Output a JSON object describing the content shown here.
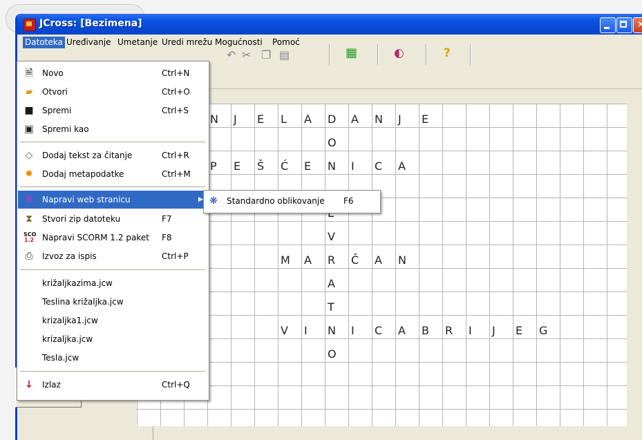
{
  "window": {
    "title": "JCross: [Bezimena]"
  },
  "menubar": [
    "Datoteka",
    "Uređivanje",
    "Umetanje",
    "Uredi mrežu",
    "Mogućnosti",
    "Pomoć"
  ],
  "file_menu": {
    "items": [
      {
        "label": "Novo",
        "shortcut": "Ctrl+N",
        "icon": "new-file-icon"
      },
      {
        "label": "Otvori",
        "shortcut": "Ctrl+O",
        "icon": "open-folder-icon"
      },
      {
        "label": "Spremi",
        "shortcut": "Ctrl+S",
        "icon": "save-disk-icon"
      },
      {
        "label": "Spremi kao",
        "shortcut": "",
        "icon": "save-as-icon"
      },
      {
        "label": "Dodaj tekst za čitanje",
        "shortcut": "Ctrl+R",
        "icon": "reading-text-icon"
      },
      {
        "label": "Dodaj metapodatke",
        "shortcut": "Ctrl+M",
        "icon": "metadata-icon"
      },
      {
        "label": "Napravi web stranicu",
        "shortcut": "",
        "icon": "web-page-icon"
      },
      {
        "label": "Stvori zip datoteku",
        "shortcut": "F7",
        "icon": "zip-icon"
      },
      {
        "label": "Napravi SCORM 1.2 paket",
        "shortcut": "F8",
        "icon": "scorm-icon"
      },
      {
        "label": "Izvoz za ispis",
        "shortcut": "Ctrl+P",
        "icon": "print-icon"
      },
      {
        "label": "križaljkazima.jcw"
      },
      {
        "label": "Teslina križaljka.jcw"
      },
      {
        "label": "krizaljka1.jcw"
      },
      {
        "label": "krizaljka.jcw"
      },
      {
        "label": "Tesla.jcw"
      },
      {
        "label": "Izlaz",
        "shortcut": "Ctrl+Q",
        "icon": "exit-arrow-icon"
      }
    ]
  },
  "submenu": {
    "label": "Standardno oblikovanje",
    "shortcut": "F6",
    "icon": "web-standard-icon"
  },
  "toolbar_icons": [
    "undo-icon",
    "cut-icon",
    "copy-icon",
    "paste-icon",
    "grid-icon",
    "paint-icon",
    "help-icon"
  ],
  "help_glyph": "?",
  "crossword": {
    "words": [
      {
        "row": 0,
        "col": 2,
        "text": "RNJELADANJE"
      },
      {
        "row": 1,
        "col": 8,
        "text": "O"
      },
      {
        "row": 2,
        "col": 3,
        "text": "PEŠĆENICA"
      },
      {
        "row": 4,
        "col": 8,
        "text": "E"
      },
      {
        "row": 5,
        "col": 8,
        "text": "V"
      },
      {
        "row": 6,
        "col": 6,
        "text": "MARČAN"
      },
      {
        "row": 7,
        "col": 8,
        "text": "A"
      },
      {
        "row": 8,
        "col": 8,
        "text": "T"
      },
      {
        "row": 9,
        "col": 6,
        "text": "VINICABRIJEG"
      },
      {
        "row": 10,
        "col": 8,
        "text": "O"
      }
    ]
  }
}
